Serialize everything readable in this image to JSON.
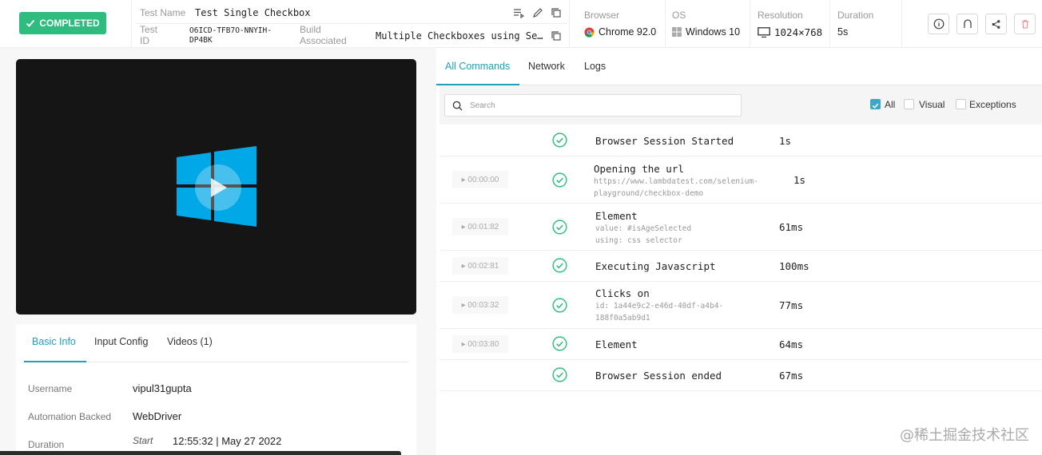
{
  "header": {
    "status": "COMPLETED",
    "test_name_label": "Test Name",
    "test_name": "Test Single Checkbox",
    "test_id_label": "Test\nID",
    "test_id": "O6ICD-TFB7O-NNYIH-\nDP4BK",
    "build_label": "Build\nAssociated",
    "build_value": "Multiple Checkboxes using Se…",
    "browser_label": "Browser",
    "browser_value": "Chrome 92.0",
    "os_label": "OS",
    "os_value": "Windows 10",
    "resolution_label": "Resolution",
    "resolution_value": "1024×768",
    "duration_label": "Duration",
    "duration_value": "5s"
  },
  "info_tabs": [
    "Basic Info",
    "Input Config",
    "Videos (1)"
  ],
  "basic_info": {
    "username_label": "Username",
    "username": "vipul31gupta",
    "automation_label": "Automation Backed",
    "automation": "WebDriver",
    "duration_label": "Duration",
    "start_label": "Start",
    "start_value": "12:55:32 | May 27 2022"
  },
  "right_tabs": [
    "All Commands",
    "Network",
    "Logs"
  ],
  "search": {
    "placeholder": "Search"
  },
  "filters": {
    "all": "All",
    "visual": "Visual",
    "exceptions": "Exceptions"
  },
  "commands": [
    {
      "time": "",
      "title": "Browser Session Started",
      "sub": "",
      "duration": "1s"
    },
    {
      "time": "▸ 00:00:00",
      "title": "Opening the url",
      "sub": "https://www.lambdatest.com/selenium-\nplayground/checkbox-demo",
      "duration": "1s"
    },
    {
      "time": "▸ 00:01:82",
      "title": "Element",
      "sub": "value: #isAgeSelected\nusing: css selector",
      "duration": "61ms"
    },
    {
      "time": "▸ 00:02:81",
      "title": "Executing Javascript",
      "sub": "",
      "duration": "100ms"
    },
    {
      "time": "▸ 00:03:32",
      "title": "Clicks on",
      "sub": "id: 1a44e9c2-e46d-40df-a4b4-\n188f0a5ab9d1",
      "duration": "77ms"
    },
    {
      "time": "▸ 00:03:80",
      "title": "Element",
      "sub": "",
      "duration": "64ms"
    },
    {
      "time": "",
      "title": "Browser Session ended",
      "sub": "",
      "duration": "67ms"
    }
  ],
  "watermark": "@稀土掘金技术社区",
  "colors": {
    "success": "#2fbd7f",
    "accent": "#1fa2b8",
    "video_bg": "#151515",
    "windows_logo": "#00a8e8"
  }
}
